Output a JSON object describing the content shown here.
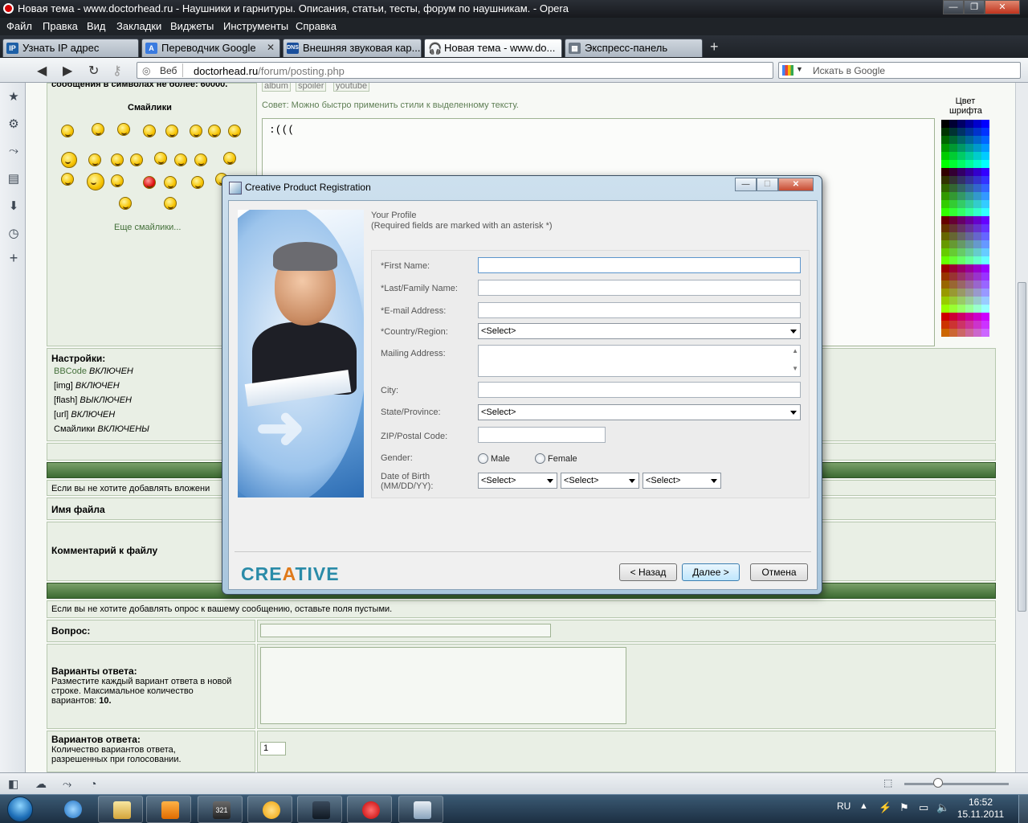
{
  "window": {
    "title": "Новая тема - www.doctorhead.ru - Наушники и гарнитуры. Описания, статьи, тесты, форум по наушникам. - Opera"
  },
  "menu": [
    "Файл",
    "Правка",
    "Вид",
    "Закладки",
    "Виджеты",
    "Инструменты",
    "Справка"
  ],
  "tabs": [
    {
      "label": "Узнать IP адрес",
      "icon": "IP"
    },
    {
      "label": "Переводчик Google",
      "icon": "A"
    },
    {
      "label": "Внешняя звуковая кар...",
      "icon": "DNS"
    },
    {
      "label": "Новая тема - www.do...",
      "icon": "headphones"
    },
    {
      "label": "Экспресс-панель",
      "icon": "grid"
    }
  ],
  "address": {
    "web_label": "Веб",
    "url_host": "doctorhead.ru",
    "url_path": "/forum/posting.php",
    "search_placeholder": "Искать в Google"
  },
  "forum": {
    "top_cut": "сообщения в символах не более: 60000.",
    "smilies_title": "Смайлики",
    "more_smilies": "Еще смайлики...",
    "tags": [
      "album",
      "spoiler",
      "youtube"
    ],
    "tip": "Совет: Можно быстро применить стили к выделенному тексту.",
    "message_text": ":(((",
    "font_color_label": "Цвет шрифта",
    "settings_title": "Настройки:",
    "settings": [
      {
        "name": "BBCode",
        "value": "ВКЛЮЧЕН"
      },
      {
        "name": "[img]",
        "value": "ВКЛЮЧЕН"
      },
      {
        "name": "[flash]",
        "value": "ВЫКЛЮЧЕН"
      },
      {
        "name": "[url]",
        "value": "ВКЛЮЧЕН"
      },
      {
        "name": "Смайлики",
        "value": "ВКЛЮЧЕНЫ"
      }
    ],
    "attach_hint": "Если вы не хотите добавлять вложени",
    "file_name": "Имя файла",
    "file_comment": "Комментарий к файлу",
    "poll_hint": "Если вы не хотите добавлять опрос к вашему сообщению, оставьте поля пустыми.",
    "question": "Вопрос:",
    "options_title": "Варианты ответа:",
    "options_desc_1": "Разместите каждый вариант ответа в новой",
    "options_desc_2": "строке. Максимальное количество",
    "options_desc_3_a": "вариантов:",
    "options_desc_3_b": "10.",
    "votes_title": "Вариантов ответа:",
    "votes_desc_1": "Количество вариантов ответа,",
    "votes_desc_2": "разрешенных при голосовании.",
    "votes_value": "1"
  },
  "dialog": {
    "title": "Creative Product Registration",
    "heading": "Your Profile",
    "subheading": "(Required fields are marked with an asterisk *)",
    "fields": {
      "first_name": "*First Name:",
      "last_name": "*Last/Family Name:",
      "email": "*E-mail Address:",
      "country": "*Country/Region:",
      "mailing": "Mailing Address:",
      "city": "City:",
      "state": "State/Province:",
      "zip": "ZIP/Postal Code:",
      "gender": "Gender:",
      "dob_1": "Date of Birth",
      "dob_2": "(MM/DD/YY):"
    },
    "select_default": "<Select>",
    "gender_male": "Male",
    "gender_female": "Female",
    "logo_pre": "CRE",
    "logo_a": "A",
    "logo_post": "TIVE",
    "back": "< Назад",
    "next": "Далее >",
    "cancel": "Отмена"
  },
  "tray": {
    "lang": "RU",
    "time": "16:52",
    "date": "15.11.2011"
  },
  "colors": {
    "forum_green": "#3c6a32",
    "forum_panel": "#e9efe5",
    "creative_blue": "#2a8ba8",
    "creative_orange": "#e07a1a"
  }
}
